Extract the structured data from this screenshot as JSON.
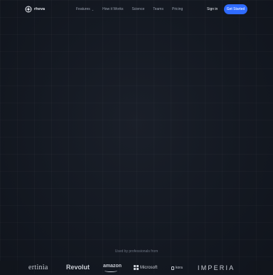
{
  "brand": {
    "name": "rheva",
    "logo_icon": "rheva-logo-icon"
  },
  "nav": {
    "items": [
      {
        "label": "Features",
        "has_dropdown": true
      },
      {
        "label": "How it Works"
      },
      {
        "label": "Science"
      },
      {
        "label": "Teams"
      },
      {
        "label": "Pricing"
      }
    ],
    "signin_label": "Sign in",
    "cta_label": "Get Started"
  },
  "colors": {
    "accent": "#2f6bff",
    "background": "#141922"
  },
  "trusted": {
    "caption": "Used by professionals from",
    "logos": [
      "ertinia",
      "Revolut",
      "amazon",
      "Microsoft",
      "kora",
      "IMPERIA"
    ]
  }
}
